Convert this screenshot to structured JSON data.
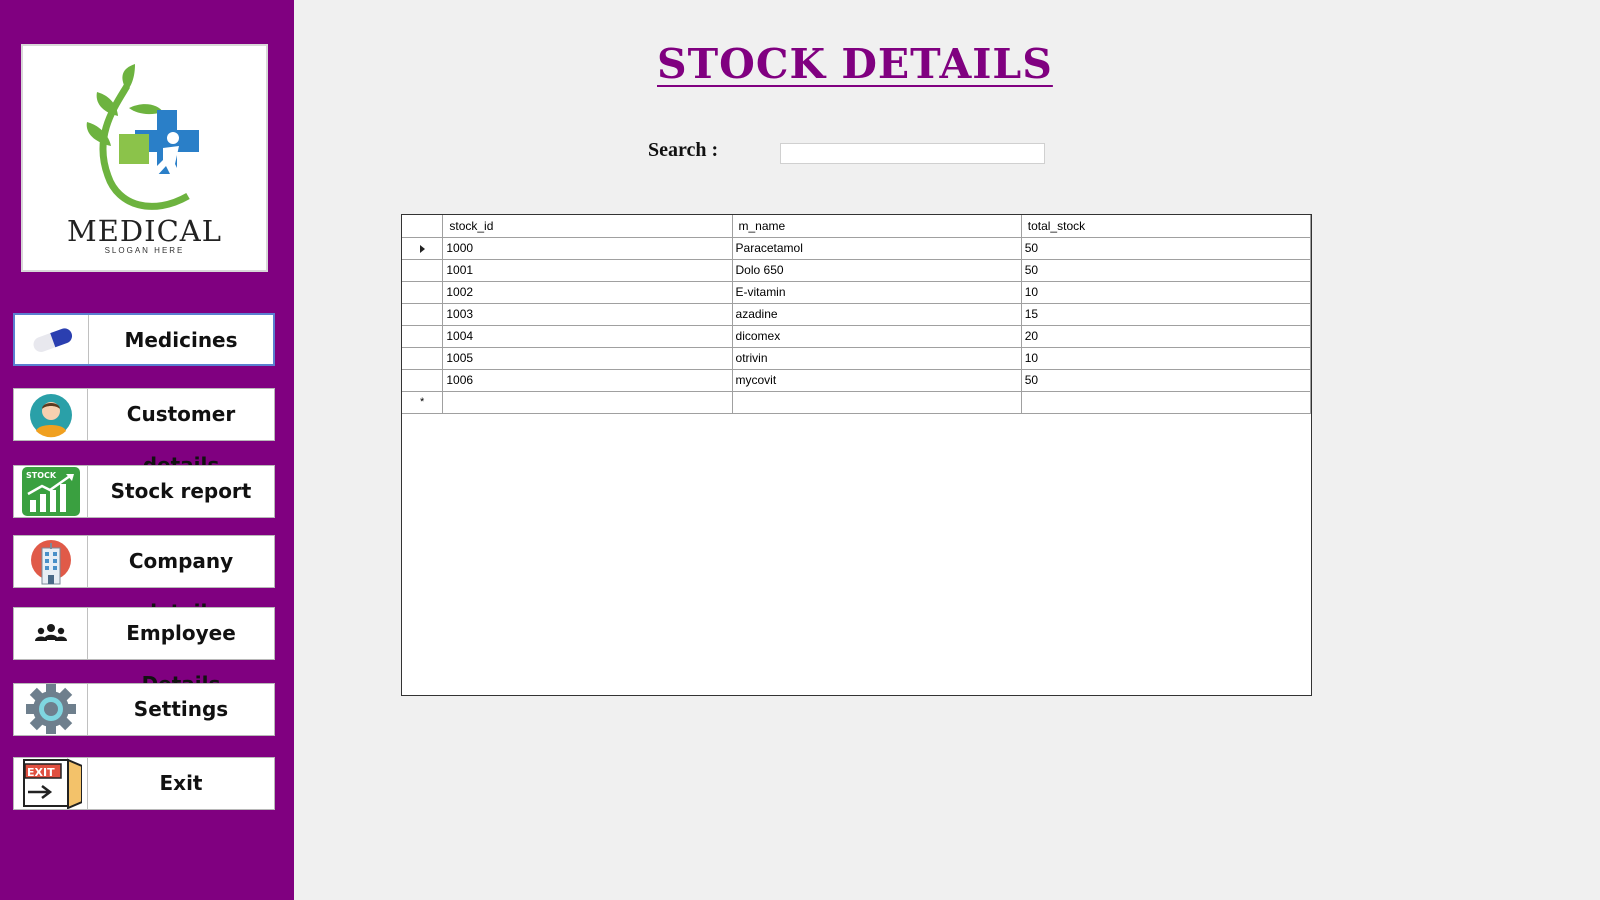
{
  "sidebar": {
    "logo": {
      "name": "MEDICAL",
      "slogan": "SLOGAN HERE"
    },
    "items": [
      {
        "label": "Medicines",
        "icon": "capsule-icon"
      },
      {
        "label": "Customer details",
        "icon": "customer-avatar-icon"
      },
      {
        "label": "Stock report",
        "icon": "stock-chart-icon"
      },
      {
        "label": "Company details",
        "icon": "company-building-icon"
      },
      {
        "label": "Employee Details",
        "icon": "employees-icon"
      },
      {
        "label": "Settings",
        "icon": "gear-icon"
      },
      {
        "label": "Exit",
        "icon": "exit-door-icon"
      }
    ]
  },
  "main": {
    "title": "STOCK DETAILS",
    "search": {
      "label": "Search :",
      "value": ""
    },
    "table": {
      "columns": [
        "stock_id",
        "m_name",
        "total_stock"
      ],
      "rows": [
        [
          "1000",
          "Paracetamol",
          "50"
        ],
        [
          "1001",
          "Dolo 650",
          "50"
        ],
        [
          "1002",
          "E-vitamin",
          "10"
        ],
        [
          "1003",
          "azadine",
          "15"
        ],
        [
          "1004",
          "dicomex",
          "20"
        ],
        [
          "1005",
          "otrivin",
          "10"
        ],
        [
          "1006",
          "mycovit",
          "50"
        ]
      ],
      "new_row_marker": "*"
    }
  },
  "colors": {
    "sidebar": "#800080",
    "title": "#800080",
    "selection": "#0078d7",
    "background": "#f0f0f0"
  }
}
